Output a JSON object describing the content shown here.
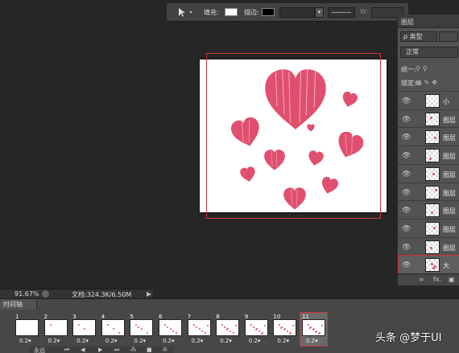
{
  "options_bar": {
    "fill_label": "填充:",
    "stroke_label": "描边:",
    "width_label": "W:",
    "fill_color": "#ffffff",
    "stroke_color": "#000000"
  },
  "layers_panel": {
    "tab_label": "图层",
    "filter_label": "ρ 类型",
    "blend_mode": "正常",
    "unify_label": "统一:",
    "lock_label": "锁定:",
    "layers": [
      {
        "name": "小"
      },
      {
        "name": "图层"
      },
      {
        "name": "图层"
      },
      {
        "name": "图层"
      },
      {
        "name": "图层"
      },
      {
        "name": "图层"
      },
      {
        "name": "图层"
      },
      {
        "name": "图层"
      },
      {
        "name": "图层"
      },
      {
        "name": "大"
      }
    ],
    "footer_link": "∞",
    "footer_fx": "fx."
  },
  "status_bar": {
    "zoom": "91.67%",
    "doc_info": "文档:324.3K/6.50M"
  },
  "timeline": {
    "tab_label": "时间轴",
    "frames": [
      {
        "num": "1",
        "delay": "0.2▾"
      },
      {
        "num": "2",
        "delay": "0.2▾"
      },
      {
        "num": "3",
        "delay": "0.2▾"
      },
      {
        "num": "4",
        "delay": "0.2▾"
      },
      {
        "num": "5",
        "delay": "0.2▾"
      },
      {
        "num": "6",
        "delay": "0.2▾"
      },
      {
        "num": "7",
        "delay": "0.2▾"
      },
      {
        "num": "8",
        "delay": "0.2▾"
      },
      {
        "num": "9",
        "delay": "0.2▾"
      },
      {
        "num": "10",
        "delay": "0.2▾"
      },
      {
        "num": "11",
        "delay": "0.2▾"
      }
    ],
    "loop_label": "永远",
    "selected_frame": "11"
  },
  "watermark": "头条 @梦于UI",
  "colors": {
    "heart": "#e0506e",
    "selection_outline": "#cc3333"
  }
}
